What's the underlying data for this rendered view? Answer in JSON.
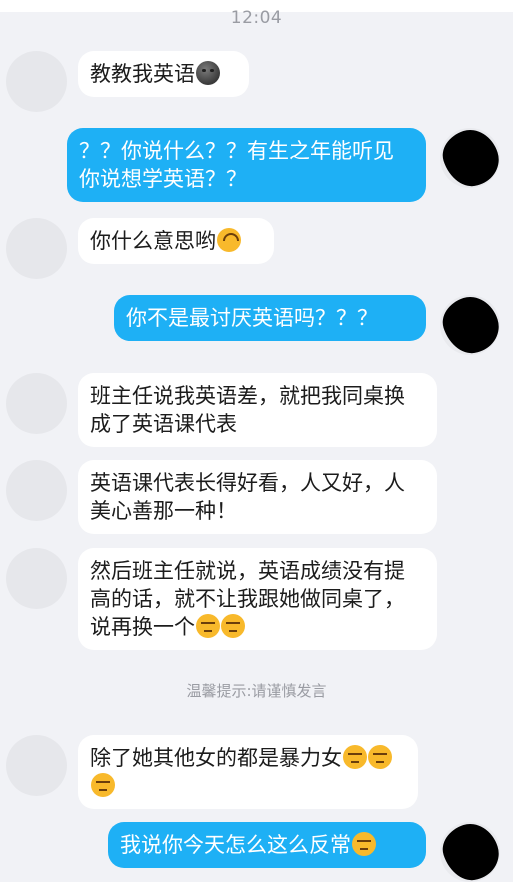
{
  "status_time": "12:04",
  "tip": "温馨提示:请谨慎发言",
  "messages": [
    {
      "side": "left",
      "text": "教教我英语",
      "emoji": [
        "last-quarter-moon-face"
      ]
    },
    {
      "side": "right",
      "text": "？？你说什么？？有生之年能听见你说想学英语？？"
    },
    {
      "side": "left",
      "text": "你什么意思哟",
      "emoji": [
        "upside-down-face"
      ]
    },
    {
      "side": "right",
      "text": "你不是最讨厌英语吗？？？"
    },
    {
      "side": "left",
      "text": "班主任说我英语差，就把我同桌换成了英语课代表"
    },
    {
      "side": "left",
      "text": "英语课代表长得好看，人又好，人美心善那一种！"
    },
    {
      "side": "left",
      "text": "然后班主任就说，英语成绩没有提高的话，就不让我跟她做同桌了，说再换一个",
      "emoji": [
        "unamused-face",
        "unamused-face"
      ]
    },
    {
      "side": "left",
      "text": "除了她其他女的都是暴力女",
      "emoji": [
        "unamused-face",
        "unamused-face",
        "unamused-face"
      ]
    },
    {
      "side": "right",
      "text": "我说你今天怎么这么反常",
      "emoji": [
        "unamused-face"
      ]
    }
  ],
  "bubble_colors": {
    "left": "#ffffff",
    "right": "#1eb0f5"
  }
}
